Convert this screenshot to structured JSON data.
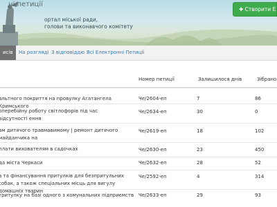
{
  "banner": {
    "title": "ні петиції",
    "subtitle1": "ортал міської ради,",
    "subtitle2": "голови та виконавчого комітету",
    "create_button": "Створити Ел"
  },
  "tabs": [
    {
      "label": "исів",
      "active": true
    },
    {
      "label": "На розгляді",
      "active": false
    },
    {
      "label": "З відповіддю",
      "active": false
    },
    {
      "label": "Всі Електронні Петиції",
      "active": false
    }
  ],
  "table": {
    "columns": [
      "Номер петиції",
      "Залишилося днів",
      "Зібрано п"
    ],
    "rows": [
      {
        "name": "альтного покриття на провулку Агатангела Кримського",
        "number": "Че/2604-еп",
        "days": "7",
        "votes": "86"
      },
      {
        "name": "оперебійну роботу світлофорів під час відсутності ення",
        "number": "Че/2634-еп",
        "days": "30",
        "votes": "0"
      },
      {
        "name": "ам дитячого травмавимому | ремонт дитячого майданчика на",
        "number": "Че/2619-еп",
        "days": "18",
        "votes": "102"
      },
      {
        "name": "плати вихователям в садочках",
        "number": "Че/2630-еп",
        "days": "23",
        "votes": "450"
      },
      {
        "name": "да міста Черкаси",
        "number": "Че/2632-еп",
        "days": "28",
        "votes": "52"
      },
      {
        "name": "а та фінансування притулків для безпритульних собак, а також спеціальних місць для вигулу домашніх тварин",
        "number": "Че/2592-еп",
        "days": "4",
        "votes": "314"
      },
      {
        "name": "тритулку на базі одного з комунальних підприємств",
        "number": "Че/2633-еп",
        "days": "29",
        "votes": "93"
      }
    ]
  },
  "colors": {
    "accent": "#3eac4d",
    "link": "#337ab7",
    "tab_active": "#717171"
  }
}
